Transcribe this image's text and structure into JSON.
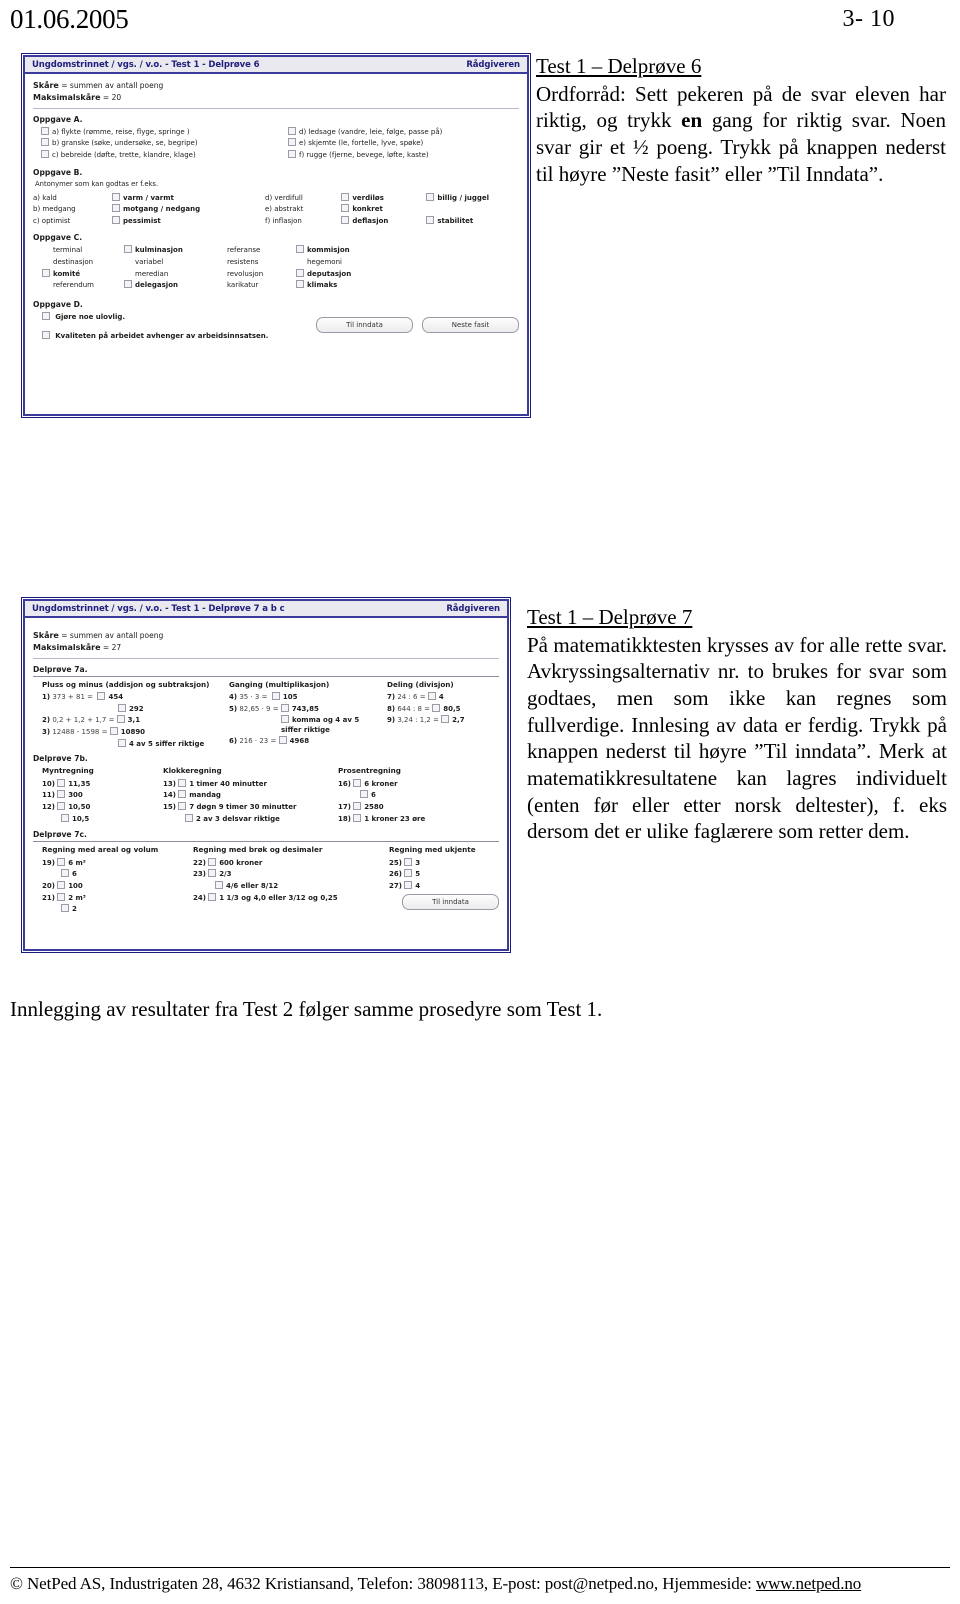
{
  "running_head": {
    "date": "01.06.2005",
    "page_number": "3- 10"
  },
  "screenshot1": {
    "titlebar": {
      "left": "Ungdomstrinnet / vgs. / v.o. - Test 1 - Delprøve 6",
      "right": "Rådgiveren"
    },
    "score_label": "Skåre",
    "score_text": "= summen av antall poeng",
    "max_label": "Maksimalskåre",
    "max_text": "= 20",
    "task_a": {
      "title": "Oppgave A.",
      "items": [
        "a) flykte (rømme, reise, flyge, springe )",
        "b) granske (søke, undersøke, se, begripe)",
        "c) bebreide (døfte, trette, klandre, klage)",
        "d) ledsage (vandre, leie, følge, passe på)",
        "e) skjemte (le, fortelle, lyve, spøke)",
        "f) rugge (fjerne, bevege, løfte, kaste)"
      ]
    },
    "task_b": {
      "title": "Oppgave B.",
      "note": "Antonymer som kan godtas er f.eks.",
      "rows": [
        {
          "cue": "a) kald",
          "ans1": "varm / varmt",
          "ans2": ""
        },
        {
          "cue": "b) medgang",
          "ans1": "motgang / nedgang",
          "ans2": ""
        },
        {
          "cue": "c) optimist",
          "ans1": "pessimist",
          "ans2": ""
        },
        {
          "cue": "d) verdifull",
          "ans1": "verdiløs",
          "ans2": "billig / juggel"
        },
        {
          "cue": "e) abstrakt",
          "ans1": "konkret",
          "ans2": ""
        },
        {
          "cue": "f) inflasjon",
          "ans1": "deflasjon",
          "ans2": "stabilitet"
        }
      ]
    },
    "task_c": {
      "title": "Oppgave C.",
      "cells": [
        {
          "text": "terminal",
          "checkbox": false,
          "bold": false
        },
        {
          "text": "kulminasjon",
          "checkbox": true,
          "bold": true
        },
        {
          "text": "referanse",
          "checkbox": false,
          "bold": false
        },
        {
          "text": "kommisjon",
          "checkbox": true,
          "bold": true
        },
        {
          "text": "destinasjon",
          "checkbox": false,
          "bold": false
        },
        {
          "text": "variabel",
          "checkbox": false,
          "bold": false
        },
        {
          "text": "resistens",
          "checkbox": false,
          "bold": false
        },
        {
          "text": "hegemoni",
          "checkbox": false,
          "bold": false
        },
        {
          "text": "komité",
          "checkbox": true,
          "bold": true
        },
        {
          "text": "meredian",
          "checkbox": false,
          "bold": false
        },
        {
          "text": "revolusjon",
          "checkbox": false,
          "bold": false
        },
        {
          "text": "deputasjon",
          "checkbox": true,
          "bold": true
        },
        {
          "text": "referendum",
          "checkbox": false,
          "bold": false
        },
        {
          "text": "delegasjon",
          "checkbox": true,
          "bold": true
        },
        {
          "text": "karikatur",
          "checkbox": false,
          "bold": false
        },
        {
          "text": "klimaks",
          "checkbox": true,
          "bold": true
        }
      ]
    },
    "task_d": {
      "title": "Oppgave D.",
      "item1": "Gjøre noe ulovlig.",
      "item2": "Kvaliteten på arbeidet avhenger av arbeidsinnsatsen."
    },
    "buttons": {
      "til_inndata": "Til inndata",
      "neste_fasit": "Neste fasit"
    }
  },
  "prose1": {
    "heading": "Test 1 – Delprøve 6",
    "body_part1": "Ordforråd: Sett pekeren på de svar eleven har riktig, og trykk ",
    "body_bold": "en",
    "body_part2": " gang for riktig svar. Noen svar gir et ½ poeng. Trykk på knappen nederst til høyre ”Neste fasit” eller ”Til Inndata”."
  },
  "screenshot2": {
    "titlebar": {
      "left": "Ungdomstrinnet / vgs. / v.o. - Test 1 - Delprøve 7 a b c",
      "right": "Rådgiveren"
    },
    "score_label": "Skåre",
    "score_text": "= summen av antall poeng",
    "max_label": "Maksimalskåre",
    "max_text": "= 27",
    "part_7a": {
      "title": "Delprøve 7a.",
      "columns": [
        {
          "heading": "Pluss og minus (addisjon og subtraksjon)",
          "rows": [
            {
              "num": "1)",
              "expr": "373 + 81 =",
              "ans": "454"
            },
            {
              "num": "",
              "expr": "",
              "ans": "292"
            },
            {
              "num": "2)",
              "expr": "0,2 + 1,2 + 1,7 =",
              "ans": "3,1"
            },
            {
              "num": "3)",
              "expr": "12488 - 1598 =",
              "ans": "10890"
            },
            {
              "num": "",
              "expr": "",
              "ans": "4 av 5 siffer riktige"
            }
          ]
        },
        {
          "heading": "Ganging (multiplikasjon)",
          "rows": [
            {
              "num": "4)",
              "expr": "35 · 3 =",
              "ans": "105"
            },
            {
              "num": "5)",
              "expr": "82,65 · 9 =",
              "ans": "743,85"
            },
            {
              "num": "",
              "expr": "",
              "ans": "komma og 4 av 5 siffer riktige"
            },
            {
              "num": "6)",
              "expr": "216 · 23 =",
              "ans": "4968"
            }
          ]
        },
        {
          "heading": "Deling (divisjon)",
          "rows": [
            {
              "num": "7)",
              "expr": "24 : 6 =",
              "ans": "4"
            },
            {
              "num": "8)",
              "expr": "644 : 8 =",
              "ans": "80,5"
            },
            {
              "num": "9)",
              "expr": "3,24 : 1,2 =",
              "ans": "2,7"
            }
          ]
        }
      ]
    },
    "part_7b": {
      "title": "Delprøve 7b.",
      "columns": [
        {
          "heading": "Myntregning",
          "rows": [
            {
              "num": "10)",
              "ans": "11,35"
            },
            {
              "num": "11)",
              "ans": "300"
            },
            {
              "num": "12)",
              "ans": "10,50"
            },
            {
              "num": "",
              "ans": "10,5"
            }
          ]
        },
        {
          "heading": "Klokkeregning",
          "rows": [
            {
              "num": "13)",
              "ans": "1 timer 40 minutter"
            },
            {
              "num": "14)",
              "ans": "mandag"
            },
            {
              "num": "15)",
              "ans": "7 døgn 9 timer 30 minutter"
            },
            {
              "num": "",
              "ans": "2 av 3 delsvar riktige"
            }
          ]
        },
        {
          "heading": "Prosentregning",
          "rows": [
            {
              "num": "16)",
              "ans": "6 kroner"
            },
            {
              "num": "",
              "ans": "6"
            },
            {
              "num": "17)",
              "ans": "2580"
            },
            {
              "num": "18)",
              "ans": "1 kroner 23 øre"
            }
          ]
        }
      ]
    },
    "part_7c": {
      "title": "Delprøve 7c.",
      "columns": [
        {
          "heading": "Regning med areal og volum",
          "rows": [
            {
              "num": "19)",
              "ans": "6 m²"
            },
            {
              "num": "",
              "ans": "6"
            },
            {
              "num": "20)",
              "ans": "100"
            },
            {
              "num": "21)",
              "ans": "2 m³"
            },
            {
              "num": "",
              "ans": "2"
            }
          ]
        },
        {
          "heading": "Regning med brøk og desimaler",
          "rows": [
            {
              "num": "22)",
              "ans": "600 kroner"
            },
            {
              "num": "23)",
              "ans": "2/3"
            },
            {
              "num": "",
              "ans": "4/6 eller 8/12"
            },
            {
              "num": "24)",
              "ans": "1 1/3 og 4,0 eller 3/12 og 0,25"
            }
          ]
        },
        {
          "heading": "Regning med ukjente",
          "rows": [
            {
              "num": "25)",
              "ans": "3"
            },
            {
              "num": "26)",
              "ans": "5"
            },
            {
              "num": "27)",
              "ans": "4"
            }
          ]
        }
      ]
    },
    "buttons": {
      "til_inndata": "Til inndata"
    }
  },
  "prose2": {
    "heading": "Test 1 – Delprøve 7",
    "body": "På matematikktesten krysses av for alle rette svar. Avkryssingsalternativ nr. to brukes for svar som godtaes, men som ikke kan regnes som fullverdige. Innlesing av data er ferdig. Trykk på knappen nederst til høyre ”Til inndata”. Merk at matematikkresultatene kan lagres individuelt (enten før eller etter norsk deltester), f. eks dersom det er ulike faglærere som retter dem."
  },
  "middle_paragraph": "Innlegging av resultater fra Test 2 følger samme prosedyre som Test 1.",
  "footer": {
    "text_before_link": "© NetPed AS, Industrigaten 28, 4632 Kristiansand,  Telefon: 38098113,  E-post: post@netped.no,  Hjemmeside: ",
    "link": "www.netped.no"
  }
}
